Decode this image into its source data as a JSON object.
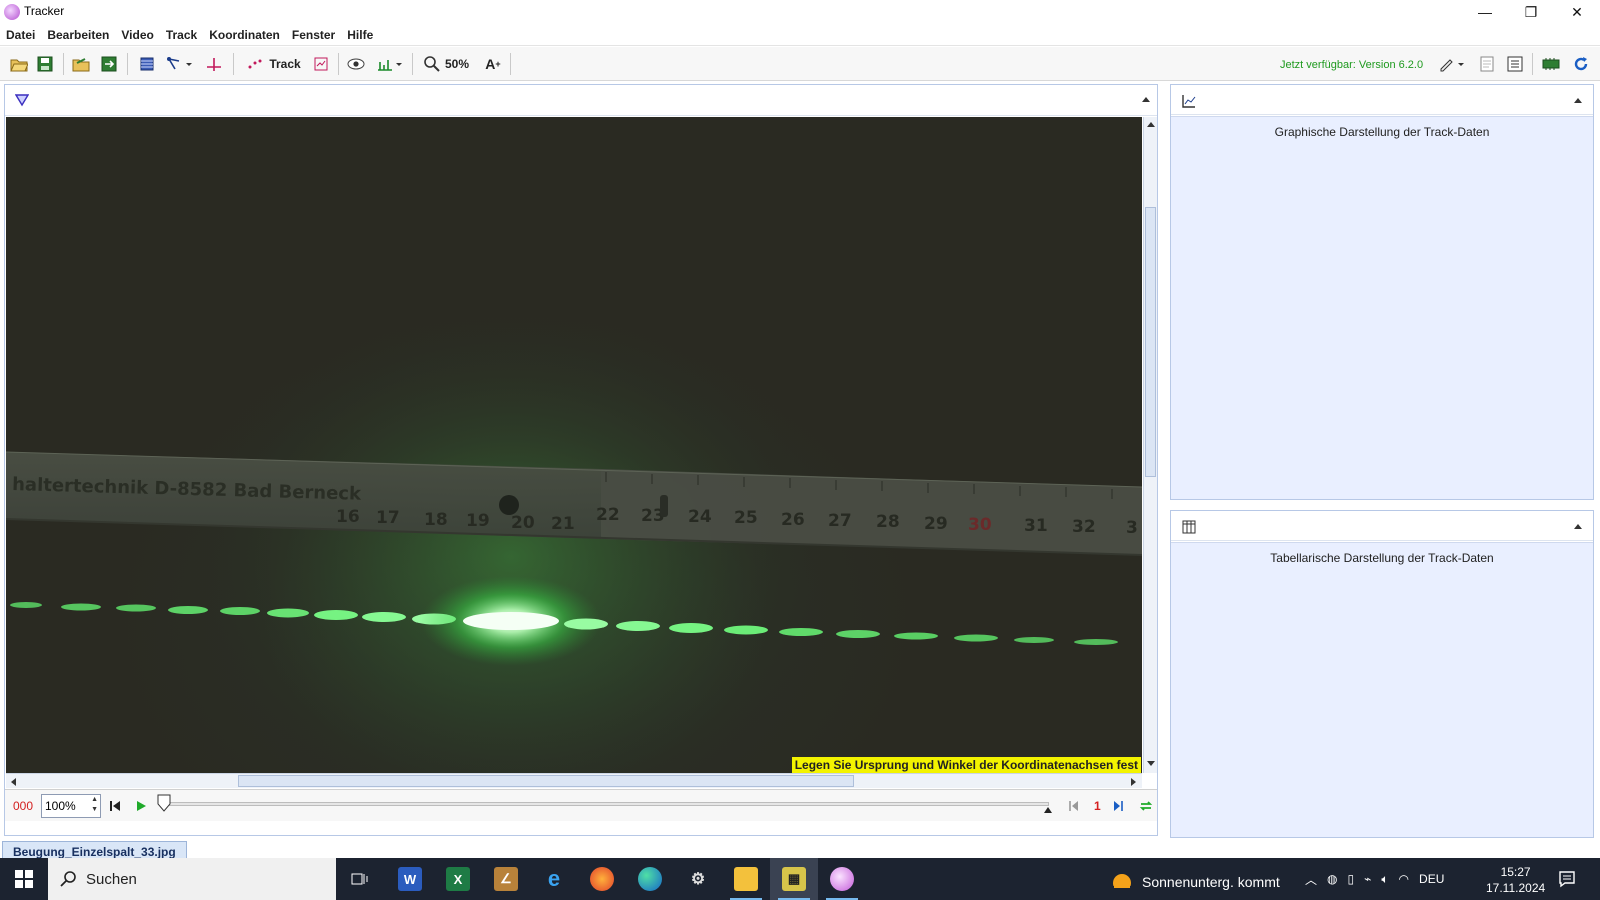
{
  "window": {
    "title": "Tracker"
  },
  "menu": [
    "Datei",
    "Bearbeiten",
    "Video",
    "Track",
    "Koordinaten",
    "Fenster",
    "Hilfe"
  ],
  "toolbar": {
    "track_label": "Track",
    "zoom_label": "50%",
    "update_text": "Jetzt verfügbar: Version 6.2.0"
  },
  "video": {
    "ruler_text": "haltertechnik D-8582 Bad Berneck",
    "ruler_numbers": [
      "16",
      "17",
      "18",
      "19",
      "20",
      "21",
      "22",
      "23",
      "24",
      "25",
      "26",
      "27",
      "28",
      "29",
      "30",
      "31",
      "32",
      "3"
    ],
    "hint": "Legen Sie Ursprung und Winkel der Koordinatenachsen fest"
  },
  "player": {
    "frame": "000",
    "rate": "100%",
    "step": "1"
  },
  "file_tab": "Beugung_Einzelspalt_33.jpg",
  "panels": {
    "graph_text": "Graphische Darstellung der Track-Daten",
    "table_text": "Tabellarische Darstellung der Track-Daten"
  },
  "taskbar": {
    "search": "Suchen",
    "weather": "Sonnenunterg. kommt",
    "language": "DEU",
    "time": "15:27",
    "date": "17.11.2024"
  },
  "colors": {
    "laser": "#6dff7a",
    "hint_bg": "#f3f300",
    "update_text": "#1f9a1f",
    "frame_counter": "#d42020"
  }
}
